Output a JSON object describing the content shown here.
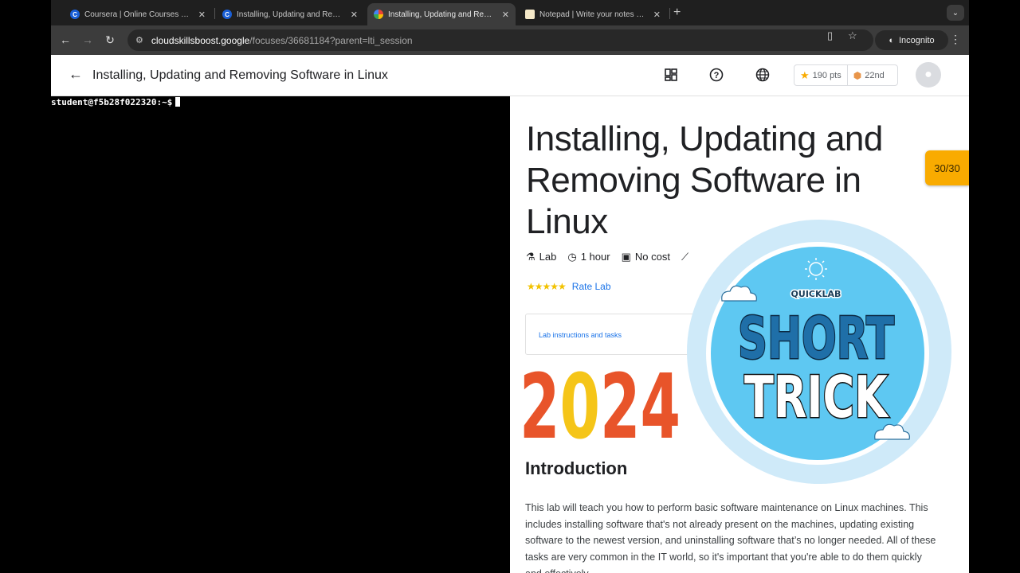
{
  "browser": {
    "tabs": [
      {
        "title": "Coursera | Online Courses From Top Universities",
        "favicon": "coursera-icon"
      },
      {
        "title": "Installing, Updating and Removing Software in Linux",
        "favicon": "coursera-icon"
      },
      {
        "title": "Installing, Updating and Removing Software in Linux",
        "favicon": "google-cloud-icon"
      },
      {
        "title": "Notepad | Write your notes online",
        "favicon": "notepad-icon"
      }
    ],
    "url_host": "cloudskillsboost.google",
    "url_path": "/focuses/36681184?parent=lti_session",
    "incognito_label": "Incognito"
  },
  "header": {
    "title": "Installing, Updating and Removing Software in Linux",
    "points": "190 pts",
    "rank": "22nd"
  },
  "terminal": {
    "prompt": "student@f5b28f022320:~$"
  },
  "lab": {
    "title": "Installing, Updating and Removing Software in Linux",
    "meta": {
      "type": "Lab",
      "duration": "1 hour",
      "cost": "No cost"
    },
    "rate_label": "Rate Lab",
    "tasks_label": "Lab instructions and tasks",
    "score": "30/30",
    "intro_heading": "Introduction",
    "intro_text": "This lab will teach you how to perform basic software maintenance on Linux machines. This includes installing software that's not already present on the machines, updating existing software to the newest version, and uninstalling software that’s no longer needed. All of these tasks are very common in the IT world, so it's important that you're able to do them quickly and effectively."
  },
  "overlay": {
    "year": "2024",
    "badge_top": "QUICKLAB",
    "badge_line1": "SHORT",
    "badge_line2": "TRICK"
  },
  "colors": {
    "accent_blue": "#1a73e8",
    "score_orange": "#f9ab00",
    "year_orange": "#e8542a",
    "year_yellow": "#f5c518",
    "badge_blue": "#5ec8f2",
    "badge_ring": "#cfeaf9"
  }
}
